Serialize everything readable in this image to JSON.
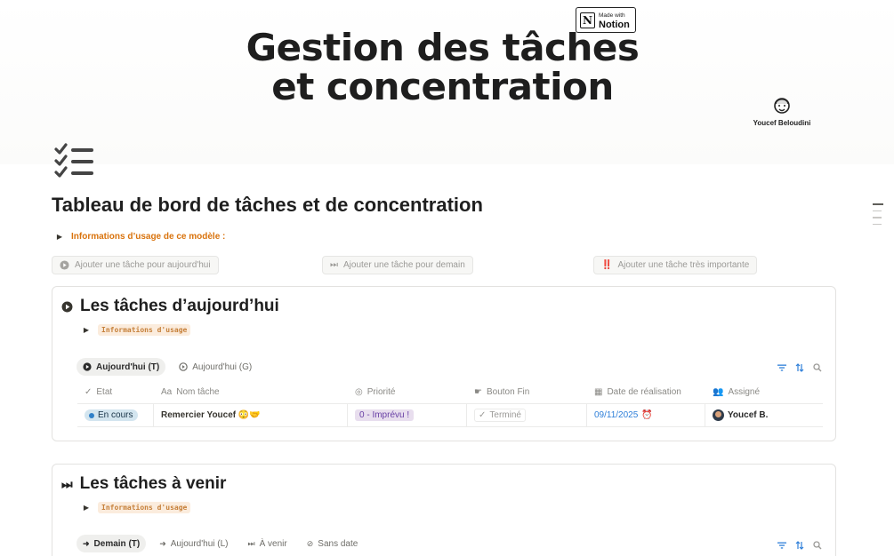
{
  "cover": {
    "title_line1": "Gestion des tâches",
    "title_line2": "et concentration",
    "badge_small": "Made with",
    "badge_big": "Notion",
    "badge_logo": "N",
    "author": "Youcef Beloudini"
  },
  "page": {
    "icon": "checklist-icon",
    "title": "Tableau de bord de tâches et de concentration",
    "usage_toggle": "Informations d’usage de ce modèle :"
  },
  "actions": [
    {
      "label": "Ajouter une tâche pour aujourd'hui",
      "icon": "play-circle-icon"
    },
    {
      "label": "Ajouter une tâche pour demain",
      "icon": "fast-forward-icon",
      "glyph": "⏭"
    },
    {
      "label": "Ajouter une tâche très importante",
      "icon": "double-exclamation-icon",
      "glyph": "‼️"
    }
  ],
  "today": {
    "title": "Les tâches d’aujourd’hui",
    "usage": "Informations d'usage",
    "views": [
      {
        "label": "Aujourd'hui (T)",
        "active": true
      },
      {
        "label": "Aujourd'hui (G)",
        "active": false
      }
    ],
    "columns": [
      {
        "label": "Etat",
        "icon": "check-icon",
        "glyph": "✓"
      },
      {
        "label": "Nom tâche",
        "icon": "text-icon",
        "glyph": "Aa"
      },
      {
        "label": "Priorité",
        "icon": "target-icon",
        "glyph": "◎"
      },
      {
        "label": "Bouton Fin",
        "icon": "pointer-icon",
        "glyph": "☛"
      },
      {
        "label": "Date de réalisation",
        "icon": "calendar-icon",
        "glyph": "▦"
      },
      {
        "label": "Assigné",
        "icon": "people-icon",
        "glyph": "👥"
      }
    ],
    "rows": [
      {
        "status": "En cours",
        "name": "Remercier Youcef 😳🤝",
        "priority": "0 - Imprévu !",
        "button": "Terminé",
        "button_glyph": "✓",
        "date": "09/11/2025",
        "date_glyph": "⏰",
        "assignee": "Youcef B."
      }
    ]
  },
  "upcoming": {
    "title": "Les tâches à venir",
    "title_glyph": "⏭",
    "usage": "Informations d'usage",
    "views": [
      {
        "label": "Demain (T)",
        "active": true,
        "glyph": "➜"
      },
      {
        "label": "Aujourd'hui (L)",
        "active": false,
        "glyph": "➜"
      },
      {
        "label": "À venir",
        "active": false,
        "glyph": "⏭"
      },
      {
        "label": "Sans date",
        "active": false,
        "glyph": "⊘"
      }
    ]
  },
  "colors": {
    "accent_orange": "#d9730d",
    "status_blue": "#d3e5ef",
    "priority_purple": "#e8deee",
    "date_blue": "#2e7fd9"
  }
}
